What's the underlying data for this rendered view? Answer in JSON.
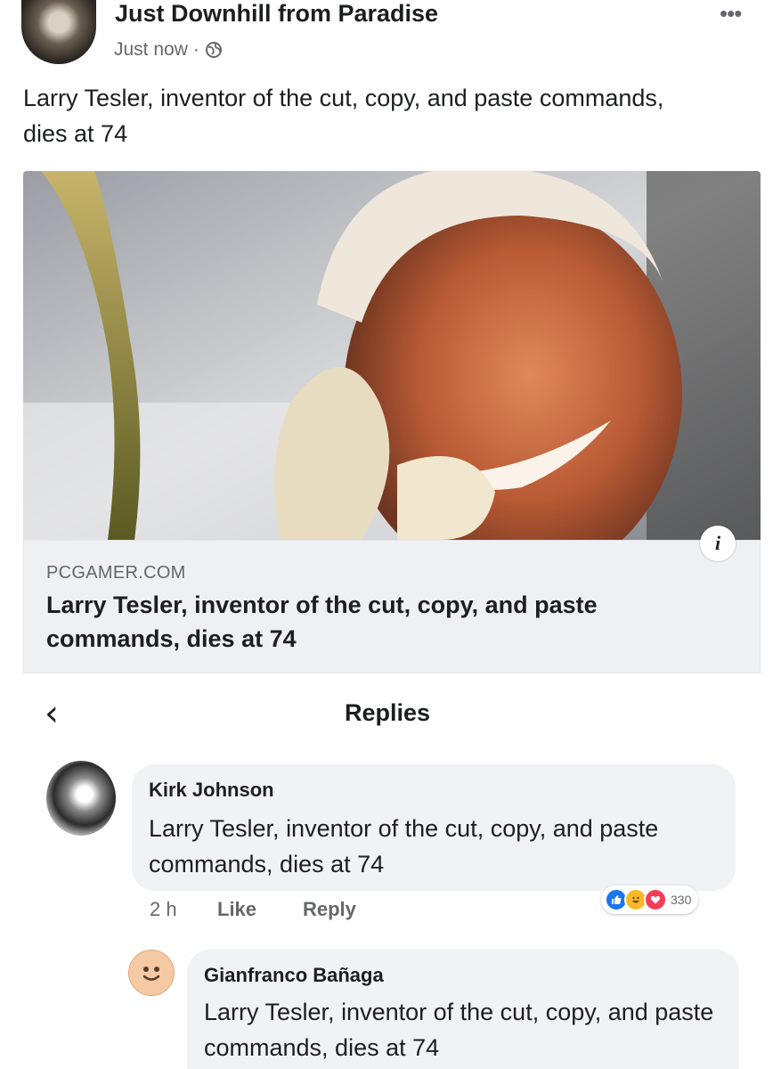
{
  "post": {
    "page_name": "Just Downhill from Paradise",
    "time": "Just now",
    "separator": "·",
    "privacy_icon": "globe-icon",
    "more_icon": "•••",
    "text": "Larry Tesler, inventor of the cut, copy, and paste commands, dies at 74"
  },
  "link_card": {
    "domain": "PCGAMER.COM",
    "title": "Larry Tesler, inventor of the cut, copy, and paste commands, dies at 74",
    "info_icon": "i"
  },
  "replies_header": {
    "back_icon": "‹",
    "title": "Replies"
  },
  "comments": [
    {
      "author": "Kirk Johnson",
      "text": "Larry Tesler, inventor of the cut, copy, and paste commands, dies at 74",
      "time": "2 h",
      "like_label": "Like",
      "reply_label": "Reply",
      "reaction_count": "330",
      "reaction_icons": [
        "like-icon",
        "haha-icon",
        "love-icon"
      ]
    },
    {
      "author": "Gianfranco Bañaga",
      "text": "Larry Tesler, inventor of the cut, copy, and paste commands, dies at 74"
    }
  ],
  "colors": {
    "accent": "#1877f2",
    "secondary_text": "#65676b",
    "bubble": "#f0f2f5"
  }
}
